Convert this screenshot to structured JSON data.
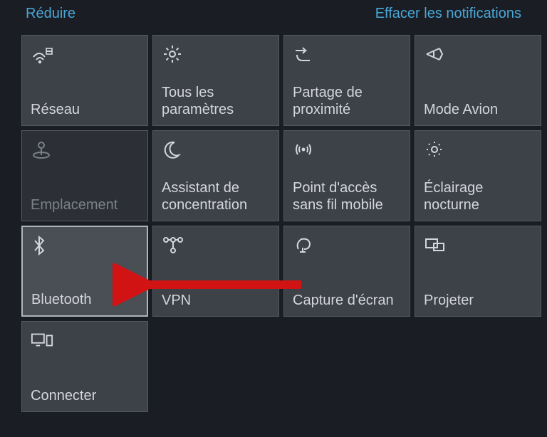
{
  "header": {
    "collapse": "Réduire",
    "clear": "Effacer les notifications"
  },
  "tiles": [
    {
      "id": "network",
      "label": "Réseau"
    },
    {
      "id": "settings",
      "label": "Tous les paramètres"
    },
    {
      "id": "nearby-sharing",
      "label": "Partage de proximité"
    },
    {
      "id": "airplane",
      "label": "Mode Avion"
    },
    {
      "id": "location",
      "label": "Emplacement"
    },
    {
      "id": "focus-assist",
      "label": "Assistant de concentration"
    },
    {
      "id": "hotspot",
      "label": "Point d'accès sans fil mobile"
    },
    {
      "id": "night-light",
      "label": "Éclairage nocturne"
    },
    {
      "id": "bluetooth",
      "label": "Bluetooth"
    },
    {
      "id": "vpn",
      "label": "VPN"
    },
    {
      "id": "screen-snip",
      "label": "Capture d'écran"
    },
    {
      "id": "project",
      "label": "Projeter"
    },
    {
      "id": "connect",
      "label": "Connecter"
    }
  ]
}
